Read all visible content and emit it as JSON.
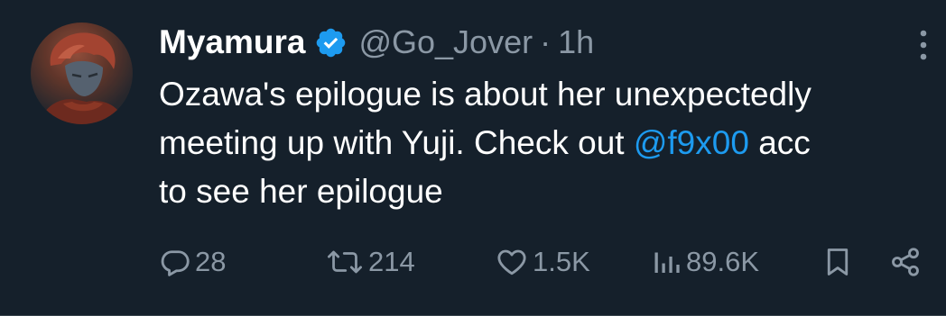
{
  "tweet": {
    "author": {
      "display_name": "Myamura",
      "verified": true,
      "handle": "@Go_Jover",
      "separator": "·",
      "timestamp": "1h"
    },
    "text": {
      "line1": "Ozawa's epilogue is about her unexpectedly",
      "line2_prefix": "meeting up with Yuji. Check out ",
      "mention": "@f9x00",
      "line2_suffix": " acc",
      "line3": "to see her epilogue"
    },
    "actions": {
      "reply_count": "28",
      "retweet_count": "214",
      "like_count": "1.5K",
      "view_count": "89.6K"
    },
    "icons": {
      "verified": "verified-badge-icon",
      "more": "more-vertical-icon",
      "reply": "reply-icon",
      "retweet": "retweet-icon",
      "like": "heart-icon",
      "views": "analytics-icon",
      "bookmark": "bookmark-icon",
      "share": "share-icon"
    },
    "colors": {
      "background": "#15202b",
      "text": "#ffffff",
      "muted": "#8b98a5",
      "accent": "#1d9bf0"
    }
  }
}
